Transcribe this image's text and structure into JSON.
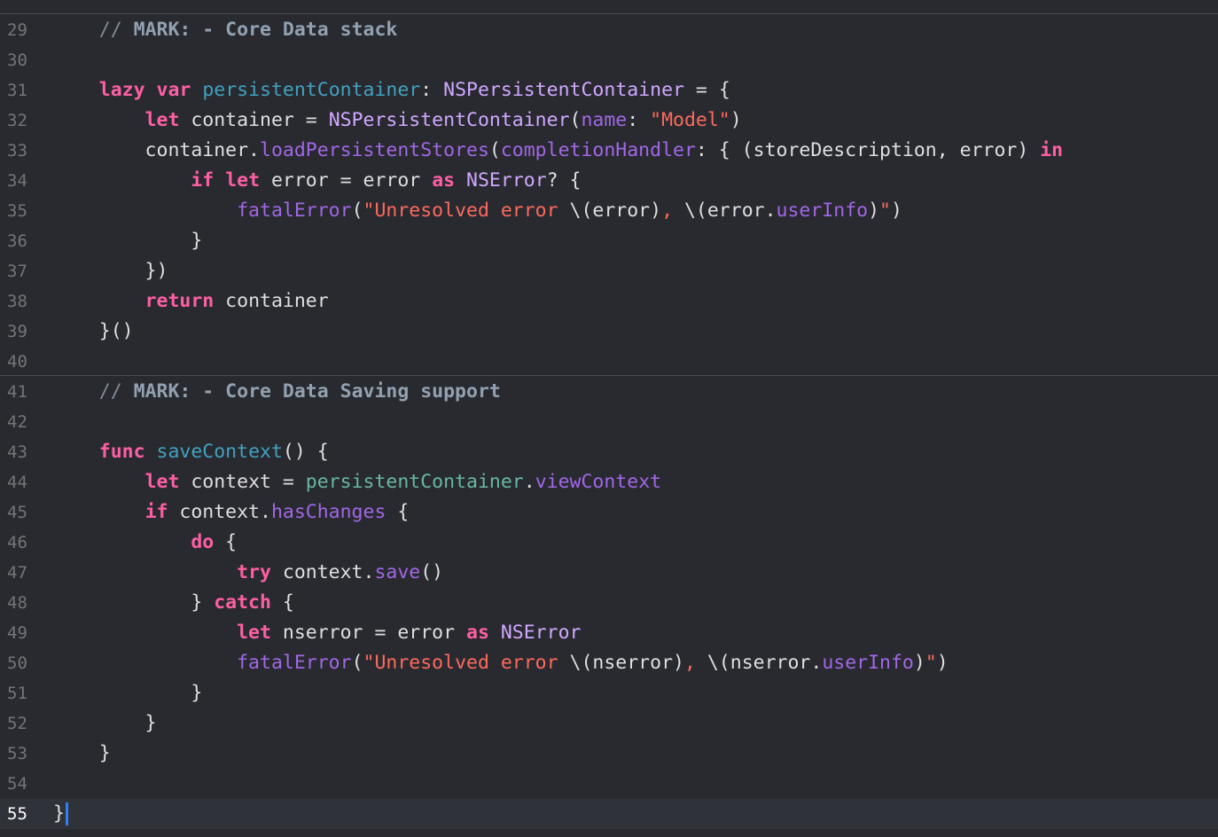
{
  "editor": {
    "current_line": 55,
    "lines": [
      {
        "n": "29",
        "segs": [
          [
            "    ",
            "pl"
          ],
          [
            "// ",
            "cmt"
          ],
          [
            "MARK: - Core Data stack",
            "mark"
          ]
        ]
      },
      {
        "n": "30",
        "segs": []
      },
      {
        "n": "31",
        "segs": [
          [
            "    ",
            "pl"
          ],
          [
            "lazy",
            "kw"
          ],
          [
            " ",
            "pl"
          ],
          [
            "var",
            "kw"
          ],
          [
            " ",
            "pl"
          ],
          [
            "persistentContainer",
            "decl"
          ],
          [
            ": ",
            "pl"
          ],
          [
            "NSPersistentContainer",
            "typ"
          ],
          [
            " = {",
            "pl"
          ]
        ]
      },
      {
        "n": "32",
        "segs": [
          [
            "        ",
            "pl"
          ],
          [
            "let",
            "kw"
          ],
          [
            " container = ",
            "pl"
          ],
          [
            "NSPersistentContainer",
            "typ"
          ],
          [
            "(",
            "pl"
          ],
          [
            "name",
            "prop"
          ],
          [
            ": ",
            "pl"
          ],
          [
            "\"Model\"",
            "str"
          ],
          [
            ")",
            "pl"
          ]
        ]
      },
      {
        "n": "33",
        "segs": [
          [
            "        container.",
            "pl"
          ],
          [
            "loadPersistentStores",
            "prop"
          ],
          [
            "(",
            "pl"
          ],
          [
            "completionHandler",
            "prop"
          ],
          [
            ": { (storeDescription, error) ",
            "pl"
          ],
          [
            "in",
            "kw"
          ]
        ]
      },
      {
        "n": "34",
        "segs": [
          [
            "            ",
            "pl"
          ],
          [
            "if",
            "kw"
          ],
          [
            " ",
            "pl"
          ],
          [
            "let",
            "kw"
          ],
          [
            " error = error ",
            "pl"
          ],
          [
            "as",
            "kw"
          ],
          [
            " ",
            "pl"
          ],
          [
            "NSError",
            "typ"
          ],
          [
            "? {",
            "pl"
          ]
        ]
      },
      {
        "n": "35",
        "segs": [
          [
            "                ",
            "pl"
          ],
          [
            "fatalError",
            "prop"
          ],
          [
            "(",
            "pl"
          ],
          [
            "\"Unresolved error ",
            "str"
          ],
          [
            "\\(error)",
            "pl"
          ],
          [
            ", ",
            "str"
          ],
          [
            "\\(error.",
            "pl"
          ],
          [
            "userInfo",
            "prop"
          ],
          [
            ")",
            "pl"
          ],
          [
            "\"",
            "str"
          ],
          [
            ")",
            "pl"
          ]
        ]
      },
      {
        "n": "36",
        "segs": [
          [
            "            }",
            "pl"
          ]
        ]
      },
      {
        "n": "37",
        "segs": [
          [
            "        })",
            "pl"
          ]
        ]
      },
      {
        "n": "38",
        "segs": [
          [
            "        ",
            "pl"
          ],
          [
            "return",
            "kw"
          ],
          [
            " container",
            "pl"
          ]
        ]
      },
      {
        "n": "39",
        "segs": [
          [
            "    }()",
            "pl"
          ]
        ]
      },
      {
        "n": "40",
        "segs": []
      },
      {
        "n": "41",
        "segs": [
          [
            "    ",
            "pl"
          ],
          [
            "// ",
            "cmt"
          ],
          [
            "MARK: - Core Data Saving support",
            "mark"
          ]
        ]
      },
      {
        "n": "42",
        "segs": []
      },
      {
        "n": "43",
        "segs": [
          [
            "    ",
            "pl"
          ],
          [
            "func",
            "kw"
          ],
          [
            " ",
            "pl"
          ],
          [
            "saveContext",
            "decl"
          ],
          [
            "() {",
            "pl"
          ]
        ]
      },
      {
        "n": "44",
        "segs": [
          [
            "        ",
            "pl"
          ],
          [
            "let",
            "kw"
          ],
          [
            " context = ",
            "pl"
          ],
          [
            "persistentContainer",
            "pc"
          ],
          [
            ".",
            "pl"
          ],
          [
            "viewContext",
            "prop"
          ]
        ]
      },
      {
        "n": "45",
        "segs": [
          [
            "        ",
            "pl"
          ],
          [
            "if",
            "kw"
          ],
          [
            " context.",
            "pl"
          ],
          [
            "hasChanges",
            "prop"
          ],
          [
            " {",
            "pl"
          ]
        ]
      },
      {
        "n": "46",
        "segs": [
          [
            "            ",
            "pl"
          ],
          [
            "do",
            "kw"
          ],
          [
            " {",
            "pl"
          ]
        ]
      },
      {
        "n": "47",
        "segs": [
          [
            "                ",
            "pl"
          ],
          [
            "try",
            "kw"
          ],
          [
            " context.",
            "pl"
          ],
          [
            "save",
            "prop"
          ],
          [
            "()",
            "pl"
          ]
        ]
      },
      {
        "n": "48",
        "segs": [
          [
            "            } ",
            "pl"
          ],
          [
            "catch",
            "kw"
          ],
          [
            " {",
            "pl"
          ]
        ]
      },
      {
        "n": "49",
        "segs": [
          [
            "                ",
            "pl"
          ],
          [
            "let",
            "kw"
          ],
          [
            " nserror = error ",
            "pl"
          ],
          [
            "as",
            "kw"
          ],
          [
            " ",
            "pl"
          ],
          [
            "NSError",
            "typ"
          ]
        ]
      },
      {
        "n": "50",
        "segs": [
          [
            "                ",
            "pl"
          ],
          [
            "fatalError",
            "prop"
          ],
          [
            "(",
            "pl"
          ],
          [
            "\"Unresolved error ",
            "str"
          ],
          [
            "\\(nserror)",
            "pl"
          ],
          [
            ", ",
            "str"
          ],
          [
            "\\(nserror.",
            "pl"
          ],
          [
            "userInfo",
            "prop"
          ],
          [
            ")",
            "pl"
          ],
          [
            "\"",
            "str"
          ],
          [
            ")",
            "pl"
          ]
        ]
      },
      {
        "n": "51",
        "segs": [
          [
            "            }",
            "pl"
          ]
        ]
      },
      {
        "n": "52",
        "segs": [
          [
            "        }",
            "pl"
          ]
        ]
      },
      {
        "n": "53",
        "segs": [
          [
            "    }",
            "pl"
          ]
        ]
      },
      {
        "n": "54",
        "segs": []
      },
      {
        "n": "55",
        "segs": [
          [
            "}",
            "pl"
          ]
        ]
      }
    ]
  },
  "colors": {
    "background": "#292a30",
    "current_line": "#2f3239",
    "keyword": "#fc5fa3",
    "declaration": "#41a1c0",
    "type": "#d0a8ff",
    "property": "#a167e6",
    "string": "#fc6a5d",
    "plain": "#dfdfe0",
    "project_symbol": "#67b7a4",
    "comment": "#7f8c98",
    "mark": "#92a1b1",
    "line_number": "#747478",
    "caret": "#2f7ff7"
  }
}
